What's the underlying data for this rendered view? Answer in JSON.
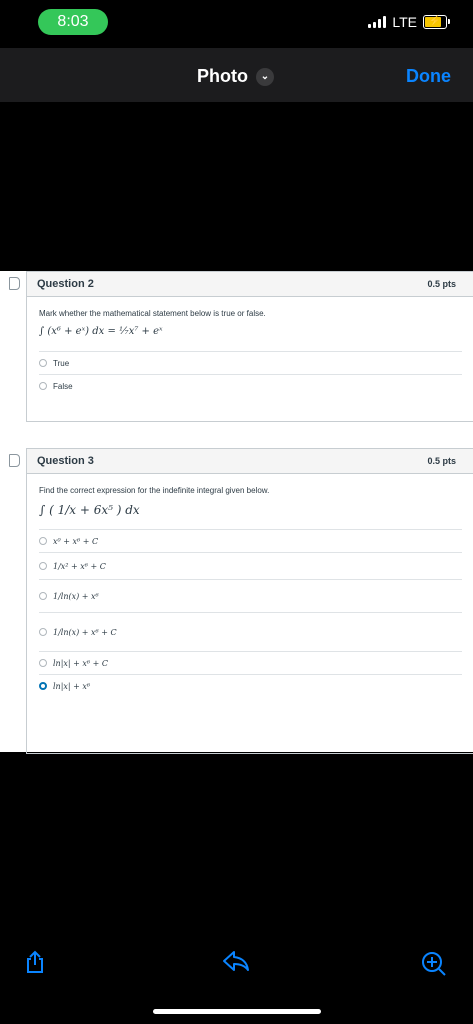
{
  "status": {
    "time": "8:03",
    "network": "LTE"
  },
  "nav": {
    "title": "Photo",
    "done": "Done"
  },
  "q2": {
    "title": "Question 2",
    "points": "0.5 pts",
    "prompt": "Mark whether the mathematical statement below is true or false.",
    "statement": "∫ (x⁶ + eˣ) dx = ¹⁄₇x⁷ + eˣ",
    "options": [
      "True",
      "False"
    ]
  },
  "q3": {
    "title": "Question 3",
    "points": "0.5 pts",
    "prompt": "Find the correct expression for the indefinite integral given below.",
    "integral": "∫ ( 1/x + 6x⁵ ) dx",
    "options": [
      "x⁰ + x⁶ + C",
      "1/x² + x⁶ + C",
      "1/ln(x) + x⁶",
      "1/ln(x) + x⁶ + C",
      "ln|x| + x⁶ + C",
      "ln|x| + x⁶"
    ],
    "selected_index": 5
  },
  "colors": {
    "accent": "#0a84ff",
    "status_green": "#34c759",
    "canvas_blue": "#0374b5"
  },
  "icons": {
    "share": "share-icon",
    "reply": "reply-icon",
    "zoom": "zoom-in-icon"
  }
}
